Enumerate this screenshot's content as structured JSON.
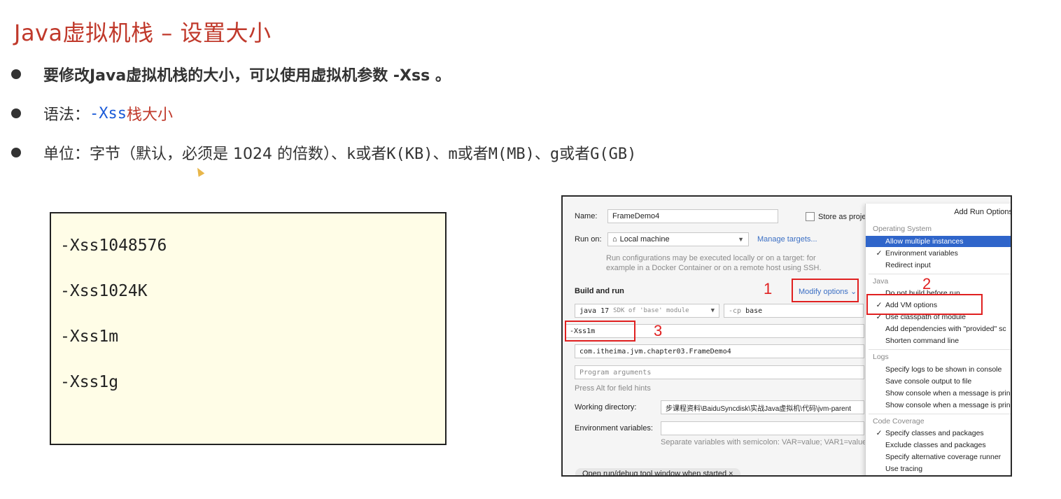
{
  "slide": {
    "title": "Java虚拟机栈 – 设置大小",
    "bullets": {
      "b1": "要修改Java虚拟机栈的大小，可以使用虚拟机参数 -Xss 。",
      "b2_prefix": "语法：",
      "b2_flag": "-Xss",
      "b2_suffix": "栈大小",
      "b3_prefix": "单位：字节（默认，必须是 1024 的倍数）、",
      "b3_mono": "k或者K(KB)、m或者M(MB)、g或者G(GB)"
    },
    "code_lines": [
      "-Xss1048576",
      "-Xss1024K",
      "-Xss1m",
      "-Xss1g"
    ]
  },
  "dialog": {
    "name_label": "Name:",
    "name_value": "FrameDemo4",
    "store_label": "Store as proje",
    "run_on_label": "Run on:",
    "run_on_value": "Local machine",
    "manage_targets": "Manage targets...",
    "run_hint_1": "Run configurations may be executed locally or on a target: for",
    "run_hint_2": "example in a Docker Container or on a remote host using SSH.",
    "build_and_run": "Build and run",
    "modify_options": "Modify options",
    "jdk_value": "java 17",
    "jdk_hint": "SDK of 'base' module",
    "cp_label": "-cp",
    "cp_value": "base",
    "vm_value": "-Xss1m",
    "main_class": "com.itheima.jvm.chapter03.FrameDemo4",
    "program_args_placeholder": "Program arguments",
    "alt_hint": "Press Alt for field hints",
    "working_dir_label": "Working directory:",
    "working_dir_value": "步课程资料\\BaiduSyncdisk\\实战Java虚拟机\\代码\\jvm-parent",
    "env_label": "Environment variables:",
    "env_hint": "Separate variables with semicolon: VAR=value; VAR1=value",
    "open_tool_window": "Open run/debug tool window when started",
    "annotations": [
      "1",
      "2",
      "3"
    ]
  },
  "popup": {
    "header": "Add Run Options",
    "os_section": "Operating System",
    "os_items": [
      "Allow multiple instances",
      "Environment variables",
      "Redirect input"
    ],
    "java_section": "Java",
    "java_items": [
      "Do not build before run",
      "Add VM options",
      "Use classpath of module",
      "Add dependencies with \"provided\" sc",
      "Shorten command line"
    ],
    "logs_section": "Logs",
    "logs_items": [
      "Specify logs to be shown in console",
      "Save console output to file",
      "Show console when a message is prin",
      "Show console when a message is prin"
    ],
    "cov_section": "Code Coverage",
    "cov_items": [
      "Specify classes and packages",
      "Exclude classes and packages",
      "Specify alternative coverage runner",
      "Use tracing"
    ],
    "check_mark": "✓"
  }
}
